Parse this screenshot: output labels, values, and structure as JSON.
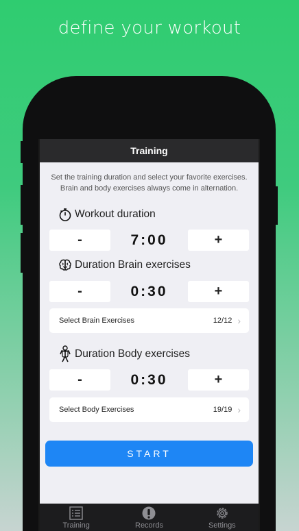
{
  "headline": "define your workout",
  "navbar": {
    "title": "Training"
  },
  "intro": "Set the training duration and select your favorite exercises. Brain and body exercises always come in alternation.",
  "workout": {
    "title": "Workout duration",
    "minus": "-",
    "value": "7:00",
    "plus": "+"
  },
  "brain": {
    "title": "Duration Brain exercises",
    "minus": "-",
    "value": "0:30",
    "plus": "+",
    "select_label": "Select Brain Exercises",
    "select_count": "12/12"
  },
  "body": {
    "title": "Duration Body exercises",
    "minus": "-",
    "value": "0:30",
    "plus": "+",
    "select_label": "Select Body Exercises",
    "select_count": "19/19"
  },
  "start_label": "START",
  "tabs": [
    {
      "label": "Training",
      "icon": "list-icon"
    },
    {
      "label": "Records",
      "icon": "info-icon"
    },
    {
      "label": "Settings",
      "icon": "gear-icon"
    }
  ],
  "colors": {
    "accent": "#1e86f5",
    "background_top": "#2fcc70",
    "screen": "#efeff4"
  }
}
